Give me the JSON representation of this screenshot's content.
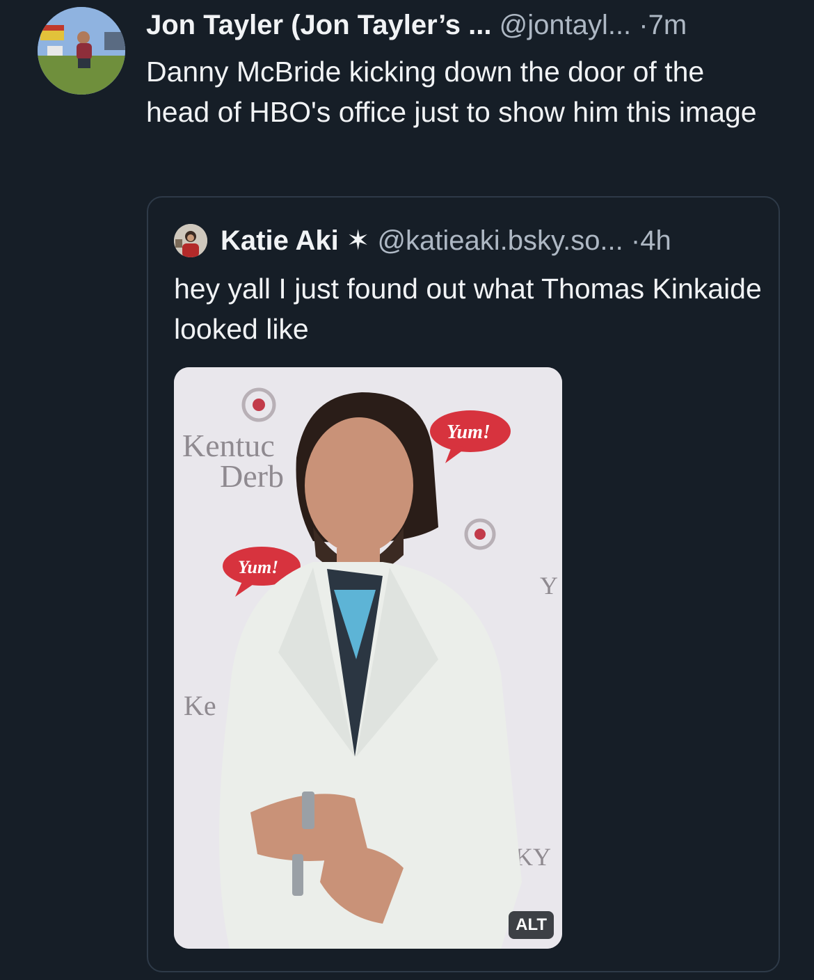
{
  "post": {
    "author_name": "Jon Tayler (Jon Tayler’s ...",
    "handle": "@jontayl...",
    "separator": "·",
    "time": "7m",
    "text": "Danny McBride kicking down the door of the head of HBO's office just to show him this image",
    "avatar_icon": "user-photo-avatar"
  },
  "quote": {
    "author_name": "Katie Aki",
    "badge_icon": "✶",
    "handle": "@katieaki.bsky.so...",
    "separator": "·",
    "time": "4h",
    "text": "hey yall I just found out what Thomas Kinkaide looked like",
    "image": {
      "backdrop_texts": [
        "Kentuc",
        "Derb",
        "Yum!",
        "Yum!",
        "Ke",
        "Y",
        "KY"
      ],
      "alt_label": "ALT"
    }
  },
  "colors": {
    "background": "#161e27",
    "text_primary": "#f1f3f5",
    "text_secondary": "#aeb8c4",
    "border": "#2e3a48"
  }
}
